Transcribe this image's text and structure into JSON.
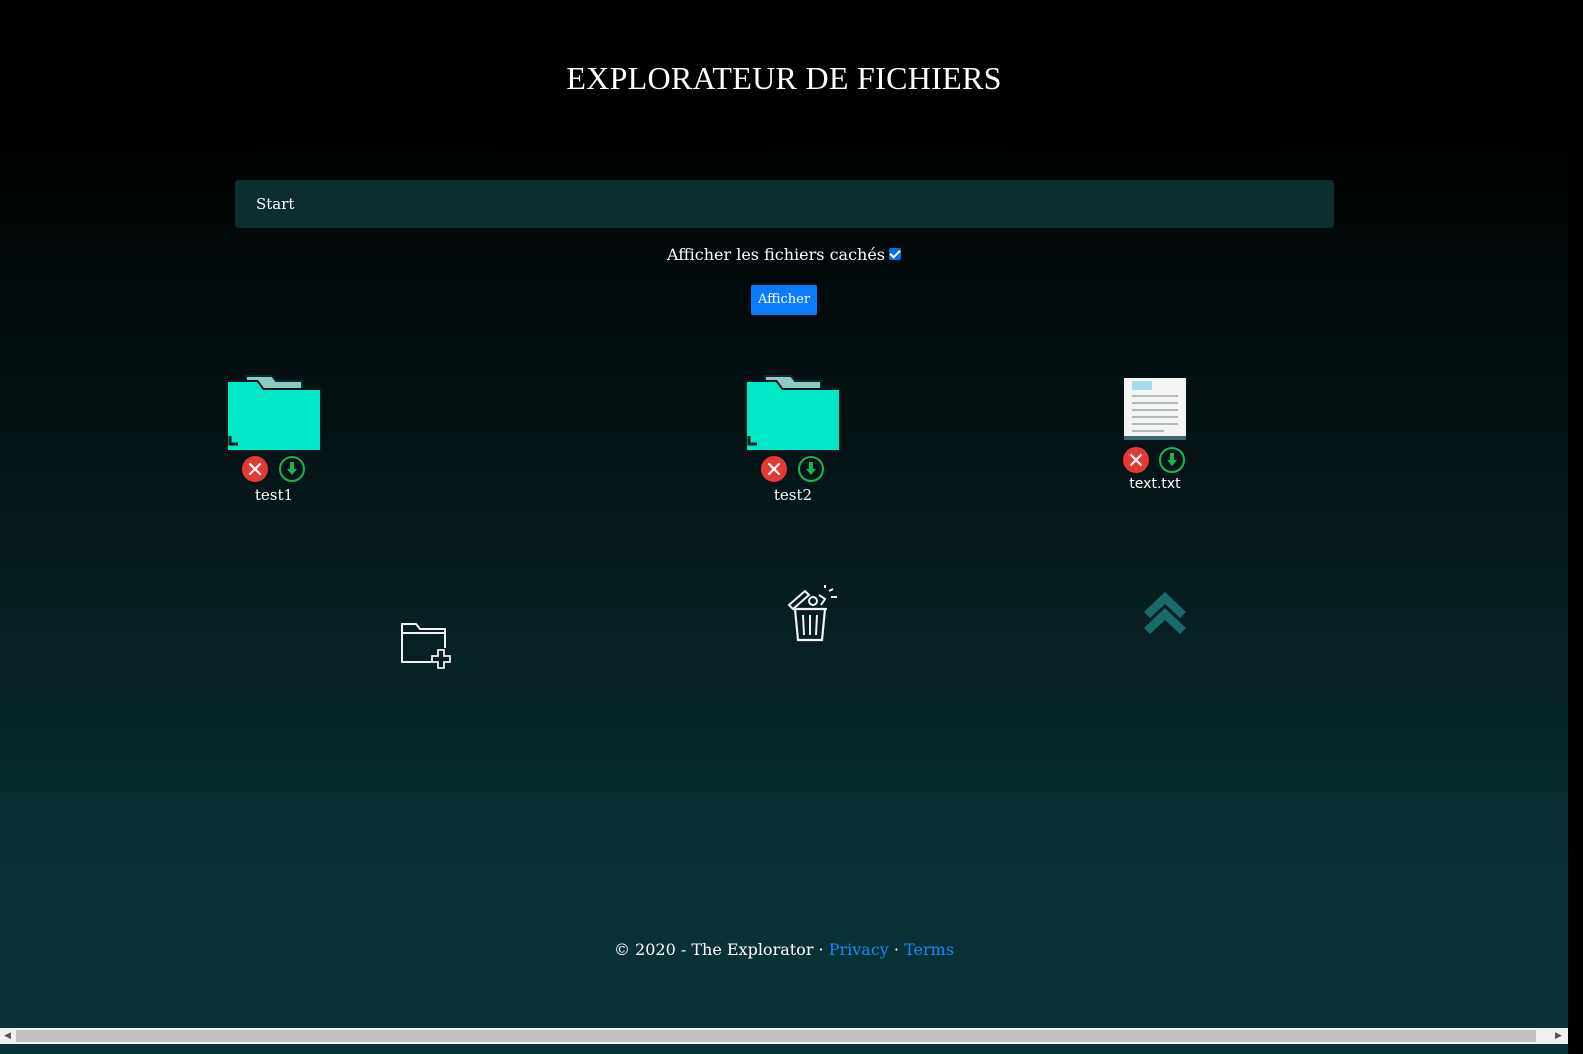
{
  "header": {
    "title": "EXPLORATEUR DE FICHIERS"
  },
  "breadcrumb": {
    "path": "Start"
  },
  "options": {
    "show_hidden_label": "Afficher les fichiers cachés",
    "show_hidden_checked": true
  },
  "actions": {
    "submit_label": "Afficher"
  },
  "items": [
    {
      "name": "test1",
      "type": "folder",
      "icon": "folder-icon"
    },
    {
      "name": "test2",
      "type": "folder",
      "icon": "folder-icon"
    },
    {
      "name": "text.txt",
      "type": "file",
      "icon": "text-file-icon"
    }
  ],
  "tools": [
    {
      "icon": "new-folder-icon"
    },
    {
      "icon": "trash-icon"
    },
    {
      "icon": "parent-directory-icon"
    }
  ],
  "footer": {
    "copyright": "© 2020 - The Explorator · ",
    "privacy": "Privacy",
    "separator": " · ",
    "terms": "Terms"
  },
  "colors": {
    "folder": "#00f0d0",
    "delete": "#e53935",
    "download": "#14b84e",
    "button": "#0a7bff",
    "link": "#1a86ff"
  }
}
